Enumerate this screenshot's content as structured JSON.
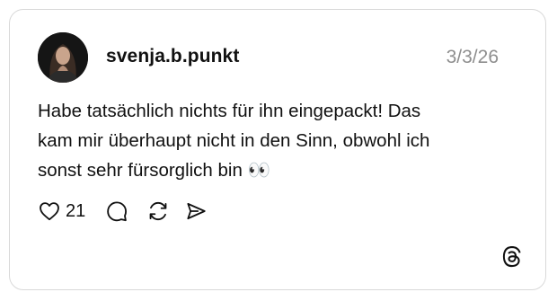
{
  "post": {
    "username": "svenja.b.punkt",
    "date": "3/3/26",
    "text_lines": [
      "Habe tatsächlich nichts für ihn eingepackt! Das",
      "kam mir überhaupt nicht in den Sinn, obwohl ich",
      "sonst sehr fürsorglich bin 👀"
    ],
    "like_count": "21"
  },
  "icons": {
    "like": "heart-outline-icon",
    "reply": "comment-bubble-icon",
    "repost": "repost-arrows-icon",
    "share": "send-paper-plane-icon",
    "brand": "threads-logo-icon"
  },
  "colors": {
    "text": "#111111",
    "muted": "#8e8e8e",
    "border": "#d9d9d9",
    "background": "#ffffff"
  }
}
